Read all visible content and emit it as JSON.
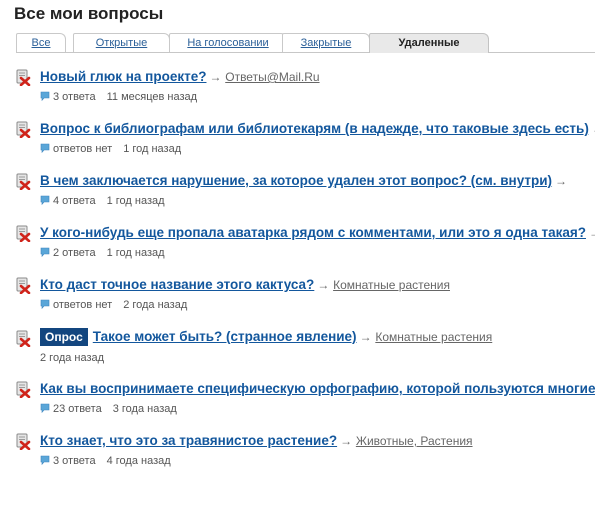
{
  "page_title": "Все мои вопросы",
  "tabs": [
    {
      "label": "Все",
      "active": false
    },
    {
      "label": "Открытые",
      "active": false
    },
    {
      "label": "На голосовании",
      "active": false
    },
    {
      "label": "Закрытые",
      "active": false
    },
    {
      "label": "Удаленные",
      "active": true
    }
  ],
  "arrow": "→",
  "questions": [
    {
      "title": "Новый глюк на проекте?",
      "category": "Ответы@Mail.Ru",
      "answers": "3 ответа",
      "time": "11 месяцев назад"
    },
    {
      "title": "Вопрос к библиографам или библиотекарям (в надежде, что таковые здесь есть)",
      "category": "",
      "answers": "ответов нет",
      "time": "1 год назад"
    },
    {
      "title": "В чем заключается нарушение, за которое удален этот вопрос? (см. внутри)",
      "category": "",
      "answers": "4 ответа",
      "time": "1 год назад"
    },
    {
      "title": "У кого-нибудь еще пропала аватарка рядом с комментами, или это я одна такая?",
      "category": "",
      "answers": "2 ответа",
      "time": "1 год назад"
    },
    {
      "title": "Кто даст точное название этого кактуса?",
      "category": "Комнатные растения",
      "answers": "ответов нет",
      "time": "2 года назад"
    },
    {
      "badge": "Опрос",
      "title": "Такое может быть? (странное явление)",
      "category": "Комнатные растения",
      "answers": "",
      "time": "2 года назад"
    },
    {
      "title": "Как вы воспринимаете специфическую орфографию, которой пользуются многие?",
      "category": "",
      "answers": "23 ответа",
      "time": "3 года назад"
    },
    {
      "title": "Кто знает, что это за травянистое растение?",
      "category": "Животные, Растения",
      "answers": "3 ответа",
      "time": "4 года назад"
    }
  ],
  "icons": {
    "deleted": "deleted-question-icon",
    "answers": "speech-bubble-icon"
  },
  "colors": {
    "link": "#13579d",
    "badge": "#13467f",
    "tab_active": "#e9e9e9",
    "bubble": "#5aa6d8",
    "deleted_red": "#d0241b"
  }
}
